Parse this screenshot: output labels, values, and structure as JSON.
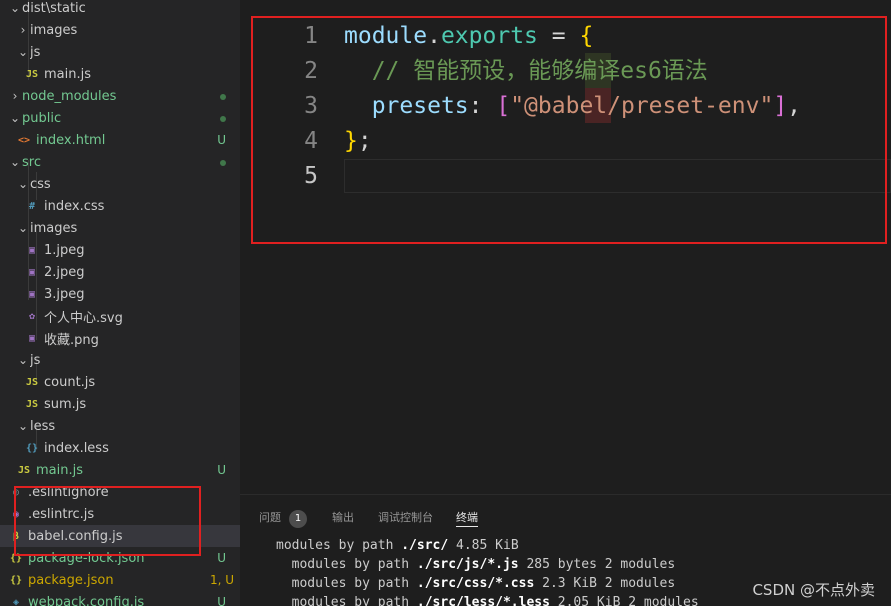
{
  "explorer": {
    "items": [
      {
        "label": "dist\\static",
        "kind": "folder",
        "open": true,
        "depth": 1,
        "icon": "folder",
        "status": ""
      },
      {
        "label": "images",
        "kind": "folder",
        "open": false,
        "depth": 2,
        "icon": "folder",
        "status": ""
      },
      {
        "label": "js",
        "kind": "folder",
        "open": true,
        "depth": 2,
        "icon": "folder",
        "status": ""
      },
      {
        "label": "main.js",
        "kind": "file",
        "depth": 3,
        "icon": "js",
        "status": ""
      },
      {
        "label": "node_modules",
        "kind": "folder",
        "open": false,
        "depth": 1,
        "icon": "folder",
        "status": "dot"
      },
      {
        "label": "public",
        "kind": "folder",
        "open": true,
        "depth": 1,
        "icon": "folder",
        "status": "dot"
      },
      {
        "label": "index.html",
        "kind": "file",
        "depth": 2,
        "icon": "html",
        "status": "U"
      },
      {
        "label": "src",
        "kind": "folder",
        "open": true,
        "depth": 1,
        "icon": "folder",
        "status": "dot"
      },
      {
        "label": "css",
        "kind": "folder",
        "open": true,
        "depth": 2,
        "icon": "folder",
        "status": ""
      },
      {
        "label": "index.css",
        "kind": "file",
        "depth": 3,
        "icon": "css",
        "status": ""
      },
      {
        "label": "images",
        "kind": "folder",
        "open": true,
        "depth": 2,
        "icon": "folder",
        "status": ""
      },
      {
        "label": "1.jpeg",
        "kind": "file",
        "depth": 3,
        "icon": "image",
        "status": ""
      },
      {
        "label": "2.jpeg",
        "kind": "file",
        "depth": 3,
        "icon": "image",
        "status": ""
      },
      {
        "label": "3.jpeg",
        "kind": "file",
        "depth": 3,
        "icon": "image",
        "status": ""
      },
      {
        "label": "个人中心.svg",
        "kind": "file",
        "depth": 3,
        "icon": "svg",
        "status": ""
      },
      {
        "label": "收藏.png",
        "kind": "file",
        "depth": 3,
        "icon": "image",
        "status": ""
      },
      {
        "label": "js",
        "kind": "folder",
        "open": true,
        "depth": 2,
        "icon": "folder",
        "status": ""
      },
      {
        "label": "count.js",
        "kind": "file",
        "depth": 3,
        "icon": "js",
        "status": ""
      },
      {
        "label": "sum.js",
        "kind": "file",
        "depth": 3,
        "icon": "js",
        "status": ""
      },
      {
        "label": "less",
        "kind": "folder",
        "open": true,
        "depth": 2,
        "icon": "folder",
        "status": ""
      },
      {
        "label": "index.less",
        "kind": "file",
        "depth": 3,
        "icon": "less",
        "status": ""
      },
      {
        "label": "main.js",
        "kind": "file",
        "depth": 2,
        "icon": "js",
        "status": "U"
      },
      {
        "label": ".eslintignore",
        "kind": "file",
        "depth": 1,
        "icon": "eslintignore",
        "status": ""
      },
      {
        "label": ".eslintrc.js",
        "kind": "file",
        "depth": 1,
        "icon": "eslint",
        "status": ""
      },
      {
        "label": "babel.config.js",
        "kind": "file",
        "depth": 1,
        "icon": "babel",
        "status": "",
        "selected": true
      },
      {
        "label": "package-lock.json",
        "kind": "file",
        "depth": 1,
        "icon": "json",
        "status": "U"
      },
      {
        "label": "package.json",
        "kind": "file",
        "depth": 1,
        "icon": "json",
        "status": "1, U"
      },
      {
        "label": "webpack.config.js",
        "kind": "file",
        "depth": 1,
        "icon": "webpack",
        "status": "U"
      }
    ]
  },
  "icons": {
    "js": {
      "glyph": "JS",
      "color": "#cbcb41"
    },
    "html": {
      "glyph": "<>",
      "color": "#e37933"
    },
    "css": {
      "glyph": "#",
      "color": "#519aba"
    },
    "image": {
      "glyph": "▣",
      "color": "#a074c4"
    },
    "svg": {
      "glyph": "✿",
      "color": "#a074c4"
    },
    "less": {
      "glyph": "{}",
      "color": "#519aba"
    },
    "json": {
      "glyph": "{}",
      "color": "#cbcb41"
    },
    "babel": {
      "glyph": "β",
      "color": "#cbcb41"
    },
    "eslint": {
      "glyph": "◉",
      "color": "#a074c4"
    },
    "eslintignore": {
      "glyph": "◎",
      "color": "#6d8086"
    },
    "webpack": {
      "glyph": "◈",
      "color": "#519aba"
    }
  },
  "colors": {
    "modified_dot": "#4c9a5a",
    "untracked": "#73c991",
    "warning": "#cca700",
    "highlight_box": "#e02020",
    "folder_text": "#73c991"
  },
  "editor": {
    "lines": [
      {
        "num": "1",
        "tokens": [
          {
            "text": "module",
            "cls": "k-var"
          },
          {
            "text": ".",
            "cls": "k-op"
          },
          {
            "text": "exports",
            "cls": "k-prop"
          },
          {
            "text": " = ",
            "cls": "k-op"
          },
          {
            "text": "{",
            "cls": "k-brace"
          }
        ]
      },
      {
        "num": "2",
        "tokens": [
          {
            "text": "  ",
            "cls": "k-op"
          },
          {
            "text": "// 智能预设，能够编译es6语法",
            "cls": "k-comment"
          }
        ]
      },
      {
        "num": "3",
        "tokens": [
          {
            "text": "  ",
            "cls": "k-op"
          },
          {
            "text": "presets",
            "cls": "k-field"
          },
          {
            "text": ": ",
            "cls": "k-op"
          },
          {
            "text": "[",
            "cls": "k-brk"
          },
          {
            "text": "\"@babel/preset-env\"",
            "cls": "k-str"
          },
          {
            "text": "]",
            "cls": "k-brk"
          },
          {
            "text": ",",
            "cls": "k-op"
          }
        ]
      },
      {
        "num": "4",
        "tokens": [
          {
            "text": "}",
            "cls": "k-brace"
          },
          {
            "text": ";",
            "cls": "k-op"
          }
        ]
      },
      {
        "num": "5",
        "tokens": []
      }
    ]
  },
  "panel": {
    "tabs": [
      {
        "label": "问题",
        "badge": "1",
        "active": false
      },
      {
        "label": "输出",
        "active": false
      },
      {
        "label": "调试控制台",
        "active": false
      },
      {
        "label": "终端",
        "active": true
      }
    ],
    "terminal": [
      {
        "indent": "",
        "pre": "modules by path ",
        "bold": "./src/",
        "post": " 4.85 KiB"
      },
      {
        "indent": "  ",
        "pre": "modules by path ",
        "bold": "./src/js/*.js",
        "post": " 285 bytes 2 modules"
      },
      {
        "indent": "  ",
        "pre": "modules by path ",
        "bold": "./src/css/*.css",
        "post": " 2.3 KiB 2 modules"
      },
      {
        "indent": "  ",
        "pre": "modules by path ",
        "bold": "./src/less/*.less",
        "post": " 2.05 KiB 2 modules"
      }
    ]
  },
  "watermark": "CSDN @不点外卖"
}
